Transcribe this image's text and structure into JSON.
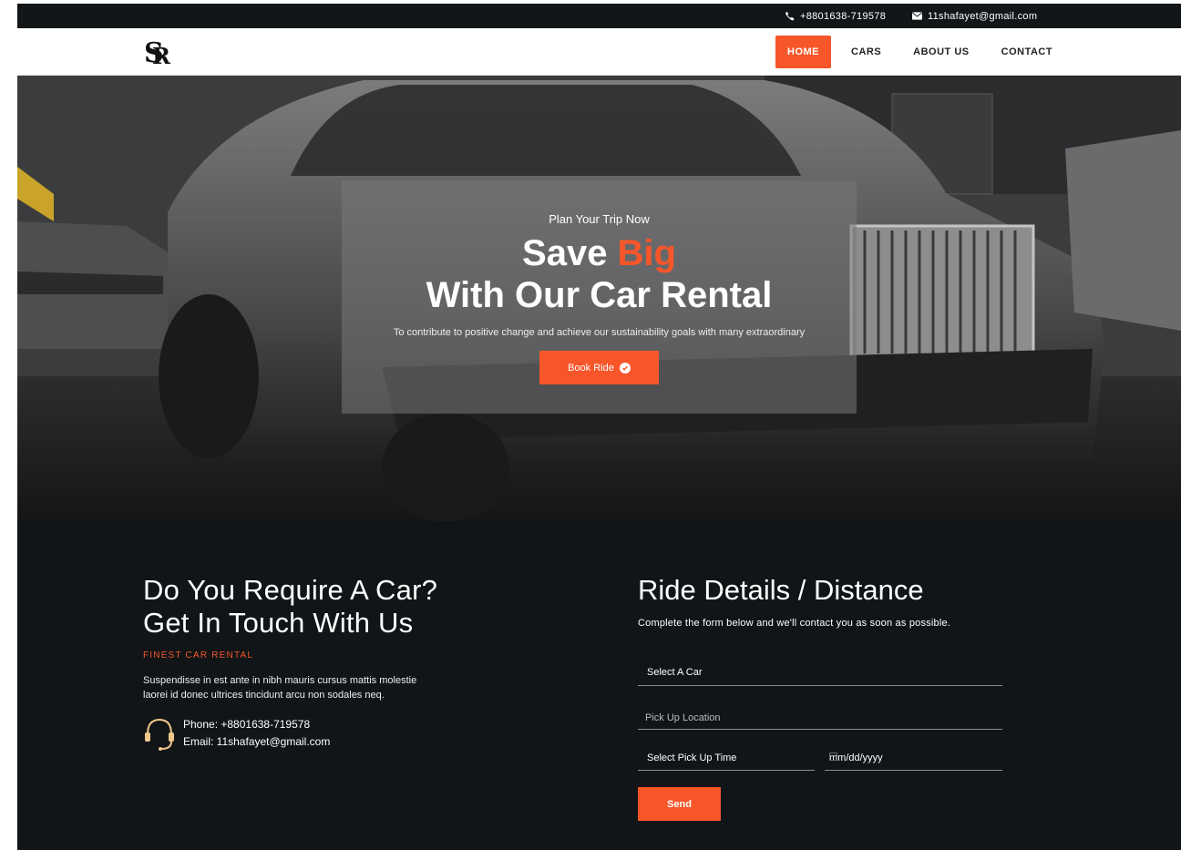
{
  "topbar": {
    "phone": "+8801638-719578",
    "email": "11shafayet@gmail.com",
    "phone_icon": "phone-icon",
    "email_icon": "envelope-icon"
  },
  "brand": {
    "logo": "SR"
  },
  "nav": {
    "items": [
      {
        "label": "HOME",
        "active": true
      },
      {
        "label": "CARS"
      },
      {
        "label": "ABOUT US"
      },
      {
        "label": "CONTACT"
      }
    ]
  },
  "hero": {
    "kicker": "Plan Your Trip Now",
    "title_part1": "Save ",
    "title_accent": "Big",
    "title_part2": " With Our Car Rental",
    "description": "To contribute to positive change and achieve our sustainability goals with many extraordinary",
    "button_label": "Book Ride",
    "button_icon": "check-circle-icon"
  },
  "contact_section": {
    "title_line1": "Do You Require A Car?",
    "title_line2": "Get In Touch With Us",
    "kicker": "FINEST CAR RENTAL",
    "text": "Suspendisse in est ante in nibh mauris cursus mattis molestie laorei id donec ultrices tincidunt arcu non sodales neq.",
    "phone_line": "Phone: +8801638-719578",
    "email_line": "Email: 11shafayet@gmail.com",
    "icon": "headset-icon"
  },
  "ride_form": {
    "title": "Ride Details / Distance",
    "subtitle": "Complete the form below and we'll contact you as soon as possible.",
    "select_car": "Select A Car",
    "pickup_location_placeholder": "Pick Up Location",
    "pickup_time": "Select Pick Up Time",
    "date_placeholder": "mm/dd/yyyy",
    "send_label": "Send"
  },
  "colors": {
    "accent": "#f7562a",
    "dark": "#111518",
    "topbar": "#121619"
  }
}
